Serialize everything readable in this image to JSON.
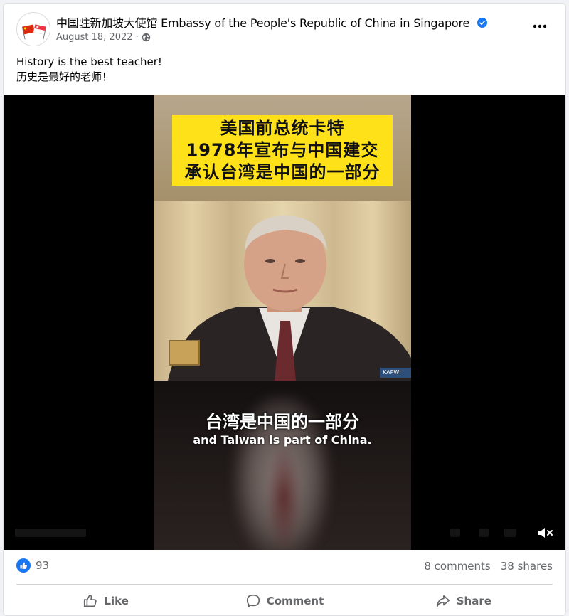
{
  "post": {
    "page_name": "中国驻新加坡大使馆 Embassy of the People's Republic of China in Singapore",
    "date": "August 18, 2022",
    "separator": "·",
    "text_line1": "History is the best teacher!",
    "text_line2": "历史是最好的老师！"
  },
  "video": {
    "caption_line1": "美国前总统卡特",
    "caption_line2": "1978年宣布与中国建交",
    "caption_line3": "承认台湾是中国的一部分",
    "watermark": "KAPWI",
    "subtitle_cn": "台湾是中国的一部分",
    "subtitle_en": "and Taiwan is part of China."
  },
  "stats": {
    "likes": "93",
    "comments": "8 comments",
    "shares": "38 shares"
  },
  "actions": {
    "like": "Like",
    "comment": "Comment",
    "share": "Share"
  },
  "colors": {
    "accent": "#1877f2",
    "caption_bg": "#ffe11a",
    "secondary_text": "#65676b"
  }
}
